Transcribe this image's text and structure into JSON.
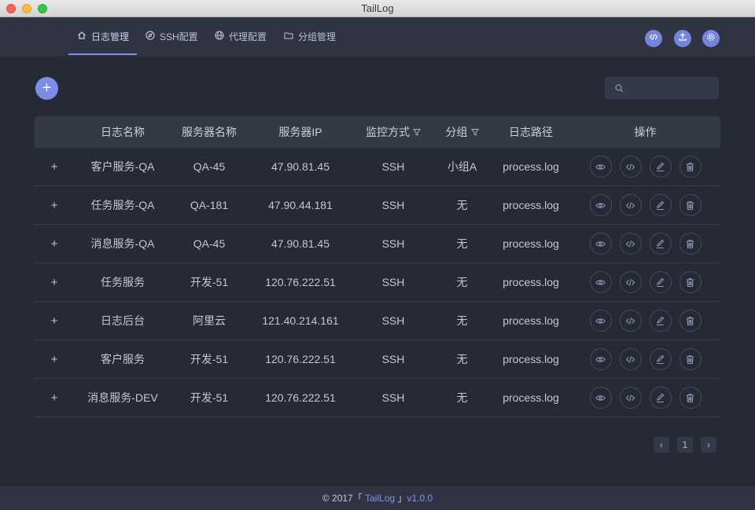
{
  "window": {
    "title": "TailLog"
  },
  "nav": {
    "tabs": [
      {
        "label": "日志管理",
        "icon": "home-icon",
        "active": true
      },
      {
        "label": "SSH配置",
        "icon": "compass-icon"
      },
      {
        "label": "代理配置",
        "icon": "globe-icon"
      },
      {
        "label": "分组管理",
        "icon": "folder-icon"
      }
    ],
    "actions": [
      "code-icon",
      "upload-icon",
      "gear-icon"
    ],
    "accent": "#7b8fe3"
  },
  "toolbar": {
    "add_label": "+",
    "search_placeholder": ""
  },
  "table": {
    "headers": {
      "name": "日志名称",
      "server_name": "服务器名称",
      "server_ip": "服务器IP",
      "monitor": "监控方式",
      "group": "分组",
      "path": "日志路径",
      "ops": "操作"
    },
    "expand_label": "+",
    "rows": [
      {
        "name": "客户服务-QA",
        "server_name": "QA-45",
        "server_ip": "47.90.81.45",
        "monitor": "SSH",
        "group": "小组A",
        "path": "process.log"
      },
      {
        "name": "任务服务-QA",
        "server_name": "QA-181",
        "server_ip": "47.90.44.181",
        "monitor": "SSH",
        "group": "无",
        "path": "process.log"
      },
      {
        "name": "消息服务-QA",
        "server_name": "QA-45",
        "server_ip": "47.90.81.45",
        "monitor": "SSH",
        "group": "无",
        "path": "process.log"
      },
      {
        "name": "任务服务",
        "server_name": "开发-51",
        "server_ip": "120.76.222.51",
        "monitor": "SSH",
        "group": "无",
        "path": "process.log"
      },
      {
        "name": "日志后台",
        "server_name": "阿里云",
        "server_ip": "121.40.214.161",
        "monitor": "SSH",
        "group": "无",
        "path": "process.log"
      },
      {
        "name": "客户服务",
        "server_name": "开发-51",
        "server_ip": "120.76.222.51",
        "monitor": "SSH",
        "group": "无",
        "path": "process.log"
      },
      {
        "name": "消息服务-DEV",
        "server_name": "开发-51",
        "server_ip": "120.76.222.51",
        "monitor": "SSH",
        "group": "无",
        "path": "process.log"
      }
    ],
    "row_actions": [
      "eye-icon",
      "code-icon",
      "edit-icon",
      "trash-icon"
    ]
  },
  "pagination": {
    "prev": "‹",
    "current": "1",
    "next": "›"
  },
  "footer": {
    "prefix": "© 2017「 ",
    "app": "TailLog",
    "suffix": " 」",
    "version": "v1.0.0"
  }
}
